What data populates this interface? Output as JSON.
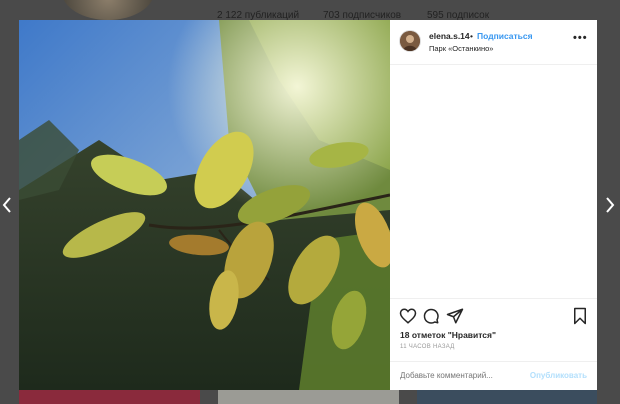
{
  "background": {
    "stats": {
      "posts": "2 122 публикаций",
      "followers": "703 подписчиков",
      "following": "595 подписок"
    }
  },
  "nav": {
    "prev_icon": "chevron-left-icon",
    "next_icon": "chevron-right-icon"
  },
  "post": {
    "username": "elena.s.14",
    "separator": "•",
    "follow_label": "Подписаться",
    "location": "Парк «Останкино»",
    "more_icon": "more-options-icon",
    "more_label": "•••",
    "likes": "18 отметок \"Нравится\"",
    "time": "11 ЧАСОВ НАЗАД",
    "comment_placeholder": "Добавьте комментарий...",
    "publish_label": "Опубликовать",
    "icons": [
      "heart-icon",
      "comment-icon",
      "share-icon",
      "bookmark-icon"
    ]
  },
  "colors": {
    "link": "#3897f0",
    "publish_disabled": "#b2dffc",
    "overlay": "#5b5b5b"
  }
}
